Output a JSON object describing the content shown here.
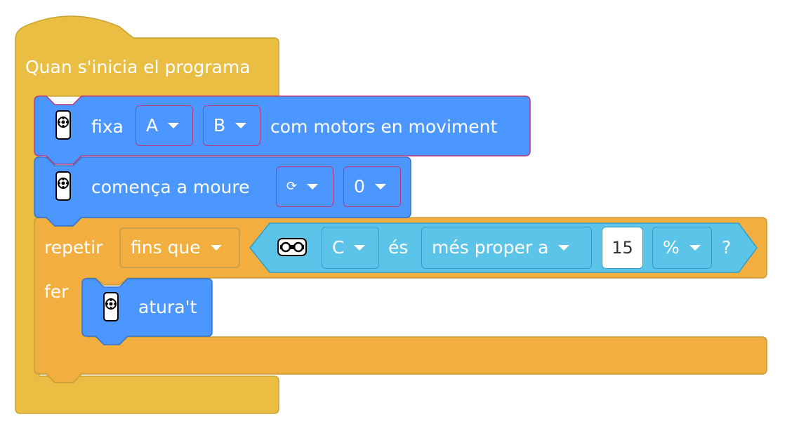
{
  "colors": {
    "event": "#eabe42",
    "motor": "#4c97ff",
    "control": "#f2ae3e",
    "sensor": "#5cc4e9"
  },
  "hat": {
    "label": "Quan s'inicia el programa"
  },
  "set_motors": {
    "label": "fixa",
    "port_a": "A",
    "port_b": "B",
    "suffix": "com motors en moviment",
    "icon": "motor-pair-icon"
  },
  "start_moving": {
    "label": "comença a moure",
    "direction": "⟳",
    "steering": "0",
    "icon": "motor-pair-icon"
  },
  "repeat": {
    "label": "repetir",
    "mode": "fins que",
    "body_label": "fer"
  },
  "condition": {
    "sensor_icon": "distance-sensor-icon",
    "port": "C",
    "verb": "és",
    "comparison": "més proper a",
    "value": "15",
    "unit": "%",
    "question": "?"
  },
  "stop": {
    "label": "atura't",
    "icon": "motor-pair-icon"
  }
}
